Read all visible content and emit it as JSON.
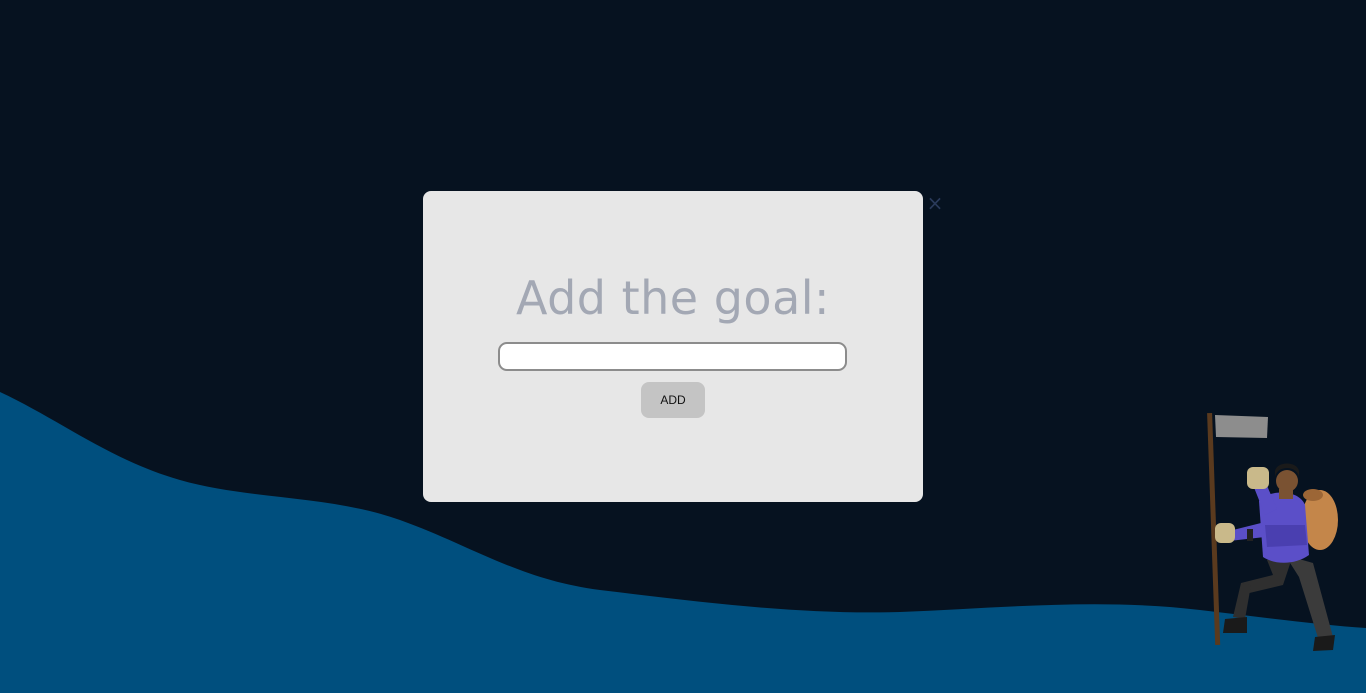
{
  "modal": {
    "title": "Add the goal:",
    "input_value": "",
    "input_placeholder": "",
    "add_label": "ADD",
    "close_label": "×"
  },
  "icons": {
    "close": "close-icon",
    "hiker": "hiker-with-flag-illustration"
  },
  "colors": {
    "background": "#061220",
    "hill": "#004f7e",
    "modal_background": "#e7e7e7",
    "title": "#a3a8b4",
    "button": "#c4c4c4",
    "close": "#2a3a5a"
  }
}
